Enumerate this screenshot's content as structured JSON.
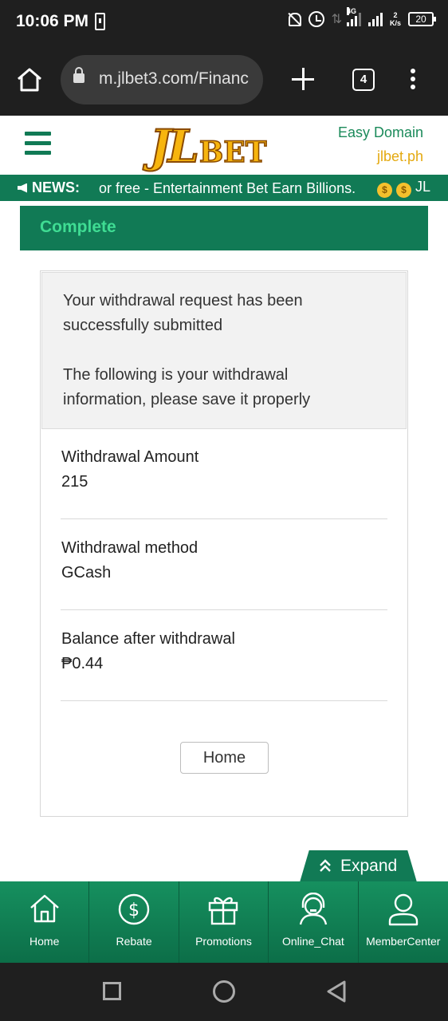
{
  "status_bar": {
    "time": "10:06 PM",
    "network": "4G",
    "speed_top": "2",
    "speed_bottom": "K/s",
    "battery": "20"
  },
  "browser": {
    "url": "m.jlbet3.com/Financ",
    "tab_count": "4"
  },
  "header": {
    "logo_part1": "JL",
    "logo_part2": "BET",
    "easy_domain": "Easy Domain",
    "domain": "jlbet.ph"
  },
  "news": {
    "label": "NEWS:",
    "text": "or free - Entertainment Bet Earn Billions.",
    "tail": "JL"
  },
  "status_title": "Complete",
  "card": {
    "message_line1": "Your withdrawal request has been",
    "message_line2": "successfully submitted",
    "info_line1": "The following is your withdrawal",
    "info_line2": "information, please save it properly",
    "rows": [
      {
        "label": "Withdrawal Amount",
        "value": "215"
      },
      {
        "label": "Withdrawal method",
        "value": "GCash"
      },
      {
        "label": "Balance after withdrawal",
        "value": "₱0.44"
      }
    ],
    "home_button": "Home"
  },
  "expand_label": "Expand",
  "bottom_nav": [
    {
      "label": "Home",
      "icon": "home-icon"
    },
    {
      "label": "Rebate",
      "icon": "dollar-icon"
    },
    {
      "label": "Promotions",
      "icon": "gift-icon"
    },
    {
      "label": "Online_Chat",
      "icon": "headset-icon"
    },
    {
      "label": "MemberCenter",
      "icon": "user-icon"
    }
  ],
  "colors": {
    "brand_green": "#117a55",
    "accent_gold": "#e4a910",
    "complete_text": "#3fdc93"
  }
}
